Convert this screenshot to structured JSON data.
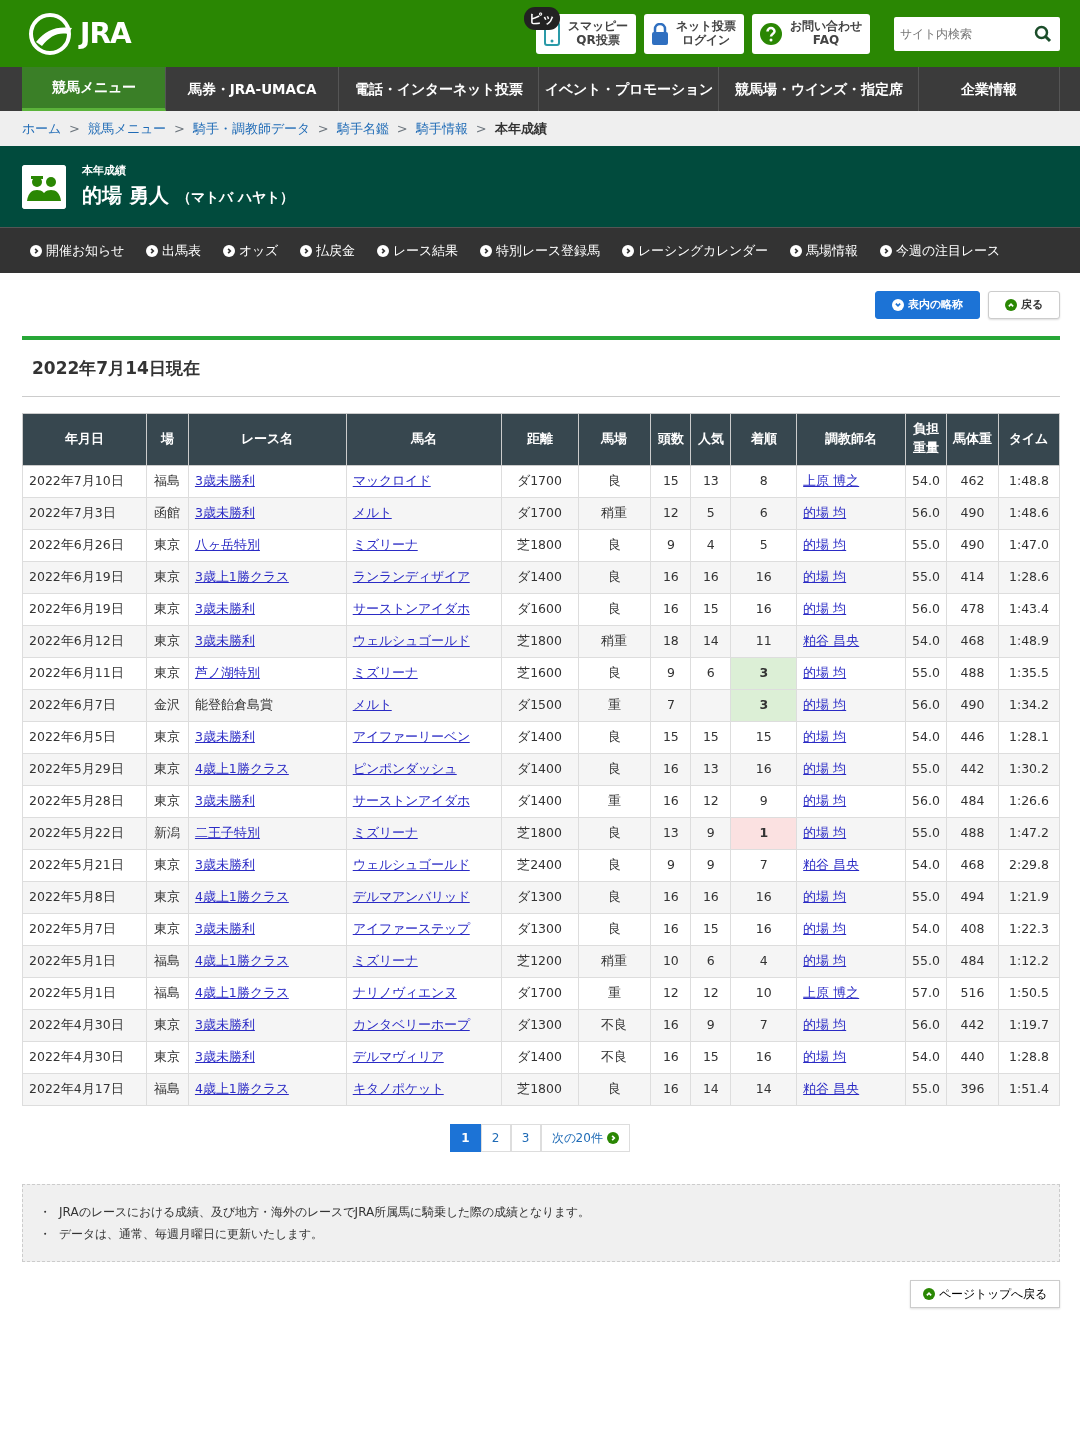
{
  "header": {
    "logo": "JRA",
    "buttons": [
      {
        "kind": "phone",
        "badge": "ピッ",
        "lines": [
          "スマッピー",
          "QR投票"
        ]
      },
      {
        "kind": "lock",
        "lines": [
          "ネット投票",
          "ログイン"
        ]
      },
      {
        "kind": "help",
        "lines": [
          "お問い合わせ",
          "FAQ"
        ]
      }
    ],
    "search": {
      "placeholder": "サイト内検索"
    }
  },
  "main_nav": [
    {
      "label": "競馬メニュー",
      "selected": true
    },
    {
      "label": "馬券・JRA-UMACA",
      "selected": false
    },
    {
      "label": "電話・インターネット投票",
      "selected": false
    },
    {
      "label": "イベント・プロモーション",
      "selected": false
    },
    {
      "label": "競馬場・ウインズ・指定席",
      "selected": false
    },
    {
      "label": "企業情報",
      "selected": false
    }
  ],
  "breadcrumb": [
    {
      "label": "ホーム",
      "link": true
    },
    {
      "separator": ">",
      "label": "競馬メニュー",
      "link": true
    },
    {
      "separator": ">",
      "label": "騎手・調教師データ",
      "link": true
    },
    {
      "separator": ">",
      "label": "騎手名鑑",
      "link": true
    },
    {
      "separator": ">",
      "label": "騎手情報",
      "link": true
    },
    {
      "separator": ">",
      "label": "本年成績",
      "link": false
    }
  ],
  "page_title": {
    "label": "本年成績",
    "name": "的場 勇人",
    "reading": "（マトバ ハヤト）"
  },
  "sub_nav": [
    "開催お知らせ",
    "出馬表",
    "オッズ",
    "払戻金",
    "レース結果",
    "特別レース登録馬",
    "レーシングカレンダー",
    "馬場情報",
    "今週の注目レース"
  ],
  "actions": [
    {
      "label": "表内の略称",
      "kind": "primary"
    },
    {
      "label": "戻る",
      "kind": "secondary"
    }
  ],
  "as_of": "2022年7月14日現在",
  "table": {
    "columns": [
      "年月日",
      "場",
      "レース名",
      "馬名",
      "距離",
      "馬場",
      "頭数",
      "人気",
      "着順",
      "調教師名",
      "負担重量",
      "馬体重",
      "タイム"
    ],
    "rows": [
      {
        "date": "2022年7月10日",
        "course": "福島",
        "race": "3歳未勝利",
        "race_linked": true,
        "horse": "マックロイド",
        "distance": "ダ1700",
        "going": "良",
        "runners": "15",
        "popularity": "13",
        "finish": "8",
        "trainer": "上原 博之",
        "weight": "54.0",
        "body_weight": "462",
        "time": "1:48.8"
      },
      {
        "date": "2022年7月3日",
        "course": "函館",
        "race": "3歳未勝利",
        "race_linked": true,
        "horse": "メルト",
        "distance": "ダ1700",
        "going": "稍重",
        "runners": "12",
        "popularity": "5",
        "finish": "6",
        "trainer": "的場 均",
        "weight": "56.0",
        "body_weight": "490",
        "time": "1:48.6"
      },
      {
        "date": "2022年6月26日",
        "course": "東京",
        "race": "八ヶ岳特別",
        "race_linked": true,
        "horse": "ミズリーナ",
        "distance": "芝1800",
        "going": "良",
        "runners": "9",
        "popularity": "4",
        "finish": "5",
        "trainer": "的場 均",
        "weight": "55.0",
        "body_weight": "490",
        "time": "1:47.0"
      },
      {
        "date": "2022年6月19日",
        "course": "東京",
        "race": "3歳上1勝クラス",
        "race_linked": true,
        "horse": "ランランディザイア",
        "distance": "ダ1400",
        "going": "良",
        "runners": "16",
        "popularity": "16",
        "finish": "16",
        "trainer": "的場 均",
        "weight": "55.0",
        "body_weight": "414",
        "time": "1:28.6"
      },
      {
        "date": "2022年6月19日",
        "course": "東京",
        "race": "3歳未勝利",
        "race_linked": true,
        "horse": "サーストンアイダホ",
        "distance": "ダ1600",
        "going": "良",
        "runners": "16",
        "popularity": "15",
        "finish": "16",
        "trainer": "的場 均",
        "weight": "56.0",
        "body_weight": "478",
        "time": "1:43.4"
      },
      {
        "date": "2022年6月12日",
        "course": "東京",
        "race": "3歳未勝利",
        "race_linked": true,
        "horse": "ウェルシュゴールド",
        "distance": "芝1800",
        "going": "稍重",
        "runners": "18",
        "popularity": "14",
        "finish": "11",
        "trainer": "粕谷 昌央",
        "weight": "54.0",
        "body_weight": "468",
        "time": "1:48.9"
      },
      {
        "date": "2022年6月11日",
        "course": "東京",
        "race": "芦ノ湖特別",
        "race_linked": true,
        "horse": "ミズリーナ",
        "distance": "芝1600",
        "going": "良",
        "runners": "9",
        "popularity": "6",
        "finish": "3",
        "highlight": {
          "color": "#dcefd6"
        },
        "trainer": "的場 均",
        "weight": "55.0",
        "body_weight": "488",
        "time": "1:35.5"
      },
      {
        "date": "2022年6月7日",
        "course": "金沢",
        "race": "能登飴倉島賞",
        "race_linked": false,
        "horse": "メルト",
        "distance": "ダ1500",
        "going": "重",
        "runners": "7",
        "finish": "3",
        "highlight": {
          "color": "#dcefd6"
        },
        "trainer": "的場 均",
        "weight": "56.0",
        "body_weight": "490",
        "time": "1:34.2"
      },
      {
        "date": "2022年6月5日",
        "course": "東京",
        "race": "3歳未勝利",
        "race_linked": true,
        "horse": "アイファーリーベン",
        "distance": "ダ1400",
        "going": "良",
        "runners": "15",
        "popularity": "15",
        "finish": "15",
        "trainer": "的場 均",
        "weight": "54.0",
        "body_weight": "446",
        "time": "1:28.1"
      },
      {
        "date": "2022年5月29日",
        "course": "東京",
        "race": "4歳上1勝クラス",
        "race_linked": true,
        "horse": "ピンポンダッシュ",
        "distance": "ダ1400",
        "going": "良",
        "runners": "16",
        "popularity": "13",
        "finish": "16",
        "trainer": "的場 均",
        "weight": "55.0",
        "body_weight": "442",
        "time": "1:30.2"
      },
      {
        "date": "2022年5月28日",
        "course": "東京",
        "race": "3歳未勝利",
        "race_linked": true,
        "horse": "サーストンアイダホ",
        "distance": "ダ1400",
        "going": "重",
        "runners": "16",
        "popularity": "12",
        "finish": "9",
        "trainer": "的場 均",
        "weight": "56.0",
        "body_weight": "484",
        "time": "1:26.6"
      },
      {
        "date": "2022年5月22日",
        "course": "新潟",
        "race": "二王子特別",
        "race_linked": true,
        "horse": "ミズリーナ",
        "distance": "芝1800",
        "going": "良",
        "runners": "13",
        "popularity": "9",
        "finish": "1",
        "highlight": {
          "color": "#fbe1e1"
        },
        "trainer": "的場 均",
        "weight": "55.0",
        "body_weight": "488",
        "time": "1:47.2"
      },
      {
        "date": "2022年5月21日",
        "course": "東京",
        "race": "3歳未勝利",
        "race_linked": true,
        "horse": "ウェルシュゴールド",
        "distance": "芝2400",
        "going": "良",
        "runners": "9",
        "popularity": "9",
        "finish": "7",
        "trainer": "粕谷 昌央",
        "weight": "54.0",
        "body_weight": "468",
        "time": "2:29.8"
      },
      {
        "date": "2022年5月8日",
        "course": "東京",
        "race": "4歳上1勝クラス",
        "race_linked": true,
        "horse": "デルマアンバリッド",
        "distance": "ダ1300",
        "going": "良",
        "runners": "16",
        "popularity": "16",
        "finish": "16",
        "trainer": "的場 均",
        "weight": "55.0",
        "body_weight": "494",
        "time": "1:21.9"
      },
      {
        "date": "2022年5月7日",
        "course": "東京",
        "race": "3歳未勝利",
        "race_linked": true,
        "horse": "アイファーステップ",
        "distance": "ダ1300",
        "going": "良",
        "runners": "16",
        "popularity": "15",
        "finish": "16",
        "trainer": "的場 均",
        "weight": "54.0",
        "body_weight": "408",
        "time": "1:22.3"
      },
      {
        "date": "2022年5月1日",
        "course": "福島",
        "race": "4歳上1勝クラス",
        "race_linked": true,
        "horse": "ミズリーナ",
        "distance": "芝1200",
        "going": "稍重",
        "runners": "10",
        "popularity": "6",
        "finish": "4",
        "trainer": "的場 均",
        "weight": "55.0",
        "body_weight": "484",
        "time": "1:12.2"
      },
      {
        "date": "2022年5月1日",
        "course": "福島",
        "race": "4歳上1勝クラス",
        "race_linked": true,
        "horse": "ナリノヴィエンヌ",
        "distance": "ダ1700",
        "going": "重",
        "runners": "12",
        "popularity": "12",
        "finish": "10",
        "trainer": "上原 博之",
        "weight": "57.0",
        "body_weight": "516",
        "time": "1:50.5"
      },
      {
        "date": "2022年4月30日",
        "course": "東京",
        "race": "3歳未勝利",
        "race_linked": true,
        "horse": "カンタベリーホープ",
        "distance": "ダ1300",
        "going": "不良",
        "runners": "16",
        "popularity": "9",
        "finish": "7",
        "trainer": "的場 均",
        "weight": "56.0",
        "body_weight": "442",
        "time": "1:19.7"
      },
      {
        "date": "2022年4月30日",
        "course": "東京",
        "race": "3歳未勝利",
        "race_linked": true,
        "horse": "デルマヴィリア",
        "distance": "ダ1400",
        "going": "不良",
        "runners": "16",
        "popularity": "15",
        "finish": "16",
        "trainer": "的場 均",
        "weight": "54.0",
        "body_weight": "440",
        "time": "1:28.8"
      },
      {
        "date": "2022年4月17日",
        "course": "福島",
        "race": "4歳上1勝クラス",
        "race_linked": true,
        "horse": "キタノポケット",
        "distance": "芝1800",
        "going": "良",
        "runners": "16",
        "popularity": "14",
        "finish": "14",
        "trainer": "粕谷 昌央",
        "weight": "55.0",
        "body_weight": "396",
        "time": "1:51.4"
      }
    ]
  },
  "pagination": {
    "pages": [
      {
        "label": "1",
        "selected": true
      },
      {
        "label": "2",
        "selected": false
      },
      {
        "label": "3",
        "selected": false
      }
    ],
    "next": "次の20件"
  },
  "notes": [
    {
      "bullet": "・",
      "text": "JRAのレースにおける成績、及び地方・海外のレースでJRA所属馬に騎乗した際の成績となります。"
    },
    {
      "bullet": "・",
      "text": "データは、通常、毎週月曜日に更新いたします。"
    }
  ],
  "page_top": "ページトップへ戻る"
}
